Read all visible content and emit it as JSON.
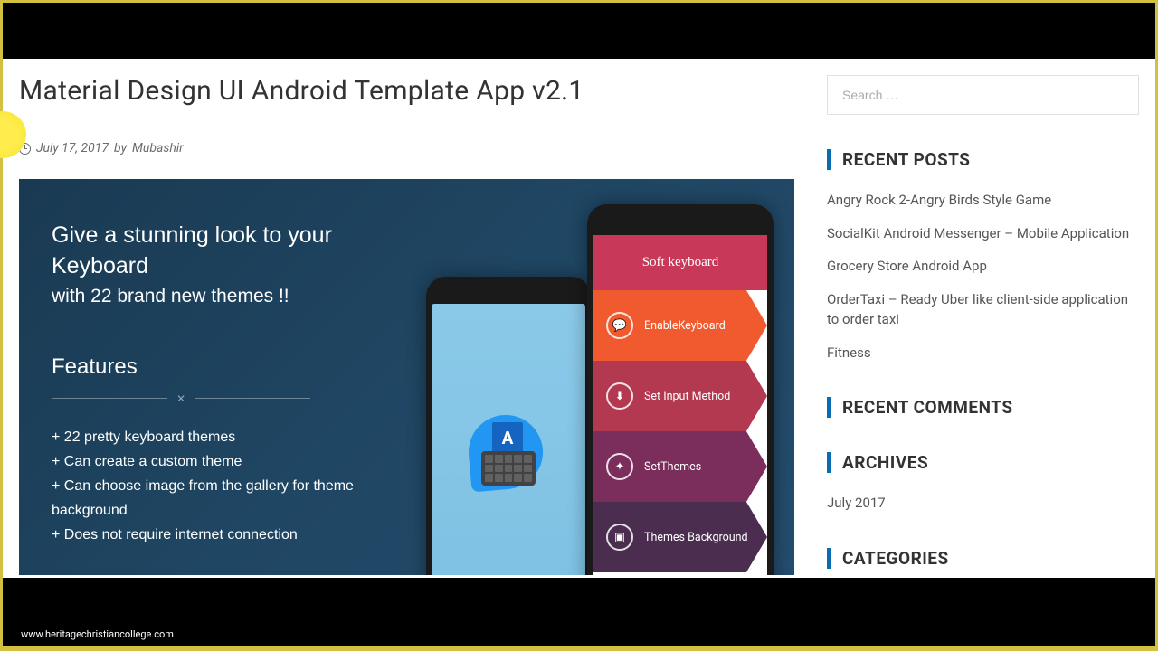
{
  "page": {
    "title": "Material Design UI Android Template App v2.1",
    "date": "July 17, 2017",
    "by_label": "by",
    "author": "Mubashir"
  },
  "hero": {
    "title": "Give a stunning look to your Keyboard",
    "subtitle": "with 22 brand new themes !!",
    "features_heading": "Features",
    "features": [
      "22 pretty keyboard themes",
      "Can create a custom theme",
      "Can choose image from the gallery for theme background",
      "Does not require internet connection"
    ],
    "phone_letter": "A",
    "phone2_header": "Soft keyboard",
    "menu_items": [
      "EnableKeyboard",
      "Set Input Method",
      "SetThemes",
      "Themes Background"
    ]
  },
  "sidebar": {
    "search_placeholder": "Search …",
    "recent_posts_title": "RECENT POSTS",
    "recent_posts": [
      "Angry Rock 2-Angry Birds Style Game",
      "SocialKit Android Messenger – Mobile Application",
      "Grocery Store Android App",
      "OrderTaxi – Ready Uber like client-side application to order taxi",
      "Fitness"
    ],
    "recent_comments_title": "RECENT COMMENTS",
    "archives_title": "ARCHIVES",
    "archives": [
      "July 2017"
    ],
    "categories_title": "CATEGORIES"
  },
  "footer": {
    "url": "www.heritagechristiancollege.com"
  }
}
